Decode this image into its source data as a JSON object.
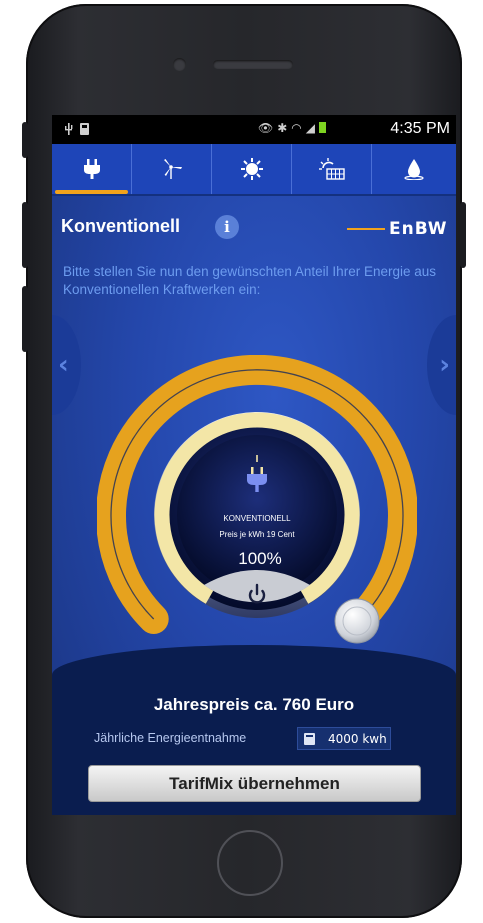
{
  "status_bar": {
    "time": "4:35 PM",
    "left_icons": [
      "usb-icon",
      "sd-card-icon"
    ],
    "right_icons": [
      "eye-icon",
      "bluetooth-icon",
      "wifi-icon",
      "signal-icon",
      "battery-icon"
    ]
  },
  "tabs": [
    {
      "icon": "plug-icon",
      "active": true
    },
    {
      "icon": "wind-turbine-icon",
      "active": false
    },
    {
      "icon": "sun-icon",
      "active": false
    },
    {
      "icon": "solar-panel-icon",
      "active": false
    },
    {
      "icon": "water-drop-icon",
      "active": false
    }
  ],
  "header": {
    "title": "Konventionell",
    "info_symbol": "i",
    "logo_text": "EnBW"
  },
  "instruction": "Bitte stellen Sie nun den gewünschten Anteil Ihrer Energie aus Konventionellen Kraftwerken ein:",
  "gauge": {
    "label": "KONVENTIONELL",
    "price_line": "Preis je kWh 19 Cent",
    "percent_text": "100%",
    "level": 1.0
  },
  "summary": {
    "price": "Jahrespreis ca. 760 Euro",
    "energy_label": "Jährliche Energieentnahme",
    "energy_value": "4000 kwh"
  },
  "cta_label": "TarifMix übernehmen",
  "colors": {
    "accent_orange": "#f2a31c",
    "brand_blue": "#2447ab",
    "tab_blue": "#1e45b8",
    "dark_navy": "#0a1d4f"
  }
}
